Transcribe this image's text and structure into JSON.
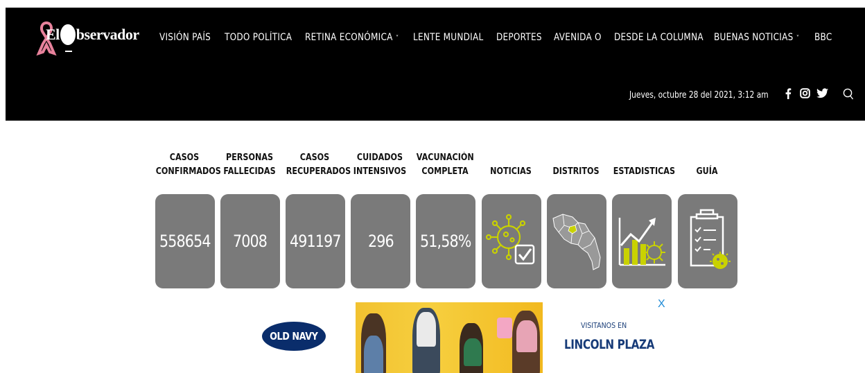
{
  "brand": {
    "name": "ElObservador",
    "logo_prefix": "El",
    "logo_suffix": "bservador"
  },
  "nav": {
    "items": [
      {
        "label": "VISIÓN PAÍS",
        "dropdown": false
      },
      {
        "label": "TODO POLÍTICA",
        "dropdown": false
      },
      {
        "label": "RETINA ECONÓMICA",
        "dropdown": true
      },
      {
        "label": "LENTE MUNDIAL",
        "dropdown": false
      },
      {
        "label": "DEPORTES",
        "dropdown": false
      },
      {
        "label": "AVENIDA O",
        "dropdown": false
      },
      {
        "label": "DESDE LA COLUMNA",
        "dropdown": false
      },
      {
        "label": "BUENAS NOTICIAS",
        "dropdown": true
      },
      {
        "label": "BBC",
        "dropdown": false
      }
    ],
    "caret": "˅"
  },
  "header": {
    "date": "Jueves, octubre 28 del 2021, 3:12 am",
    "social_icons": [
      "facebook-icon",
      "instagram-icon",
      "twitter-icon",
      "search-icon"
    ]
  },
  "stats": [
    {
      "label_1": "CASOS",
      "label_2": "CONFIRMADOS",
      "value": "558654"
    },
    {
      "label_1": "PERSONAS",
      "label_2": "FALLECIDAS",
      "value": "7008"
    },
    {
      "label_1": "CASOS",
      "label_2": "RECUPERADOS",
      "value": "491197"
    },
    {
      "label_1": "CUIDADOS",
      "label_2": "INTENSIVOS",
      "value": "296"
    },
    {
      "label_1": "VACUNACIÓN",
      "label_2": "COMPLETA",
      "value": "51,58%"
    },
    {
      "label_1": "",
      "label_2": "NOTICIAS",
      "icon": "virus-check-icon"
    },
    {
      "label_1": "",
      "label_2": "DISTRITOS",
      "icon": "map-icon"
    },
    {
      "label_1": "",
      "label_2": "ESTADISTICAS",
      "icon": "chart-virus-icon"
    },
    {
      "label_1": "",
      "label_2": "GUÍA",
      "icon": "clipboard-icon"
    }
  ],
  "ad": {
    "brand": "OLD NAVY",
    "visit_text": "VISITANOS EN",
    "location": "LINCOLN PLAZA",
    "close": "X"
  },
  "colors": {
    "header_bg": "#000000",
    "tile_bg": "#7a7a7a",
    "icon_accent": "#c9d200",
    "oldnavy_blue": "#0a2d6b",
    "ad_yellow": "#f2c230"
  }
}
